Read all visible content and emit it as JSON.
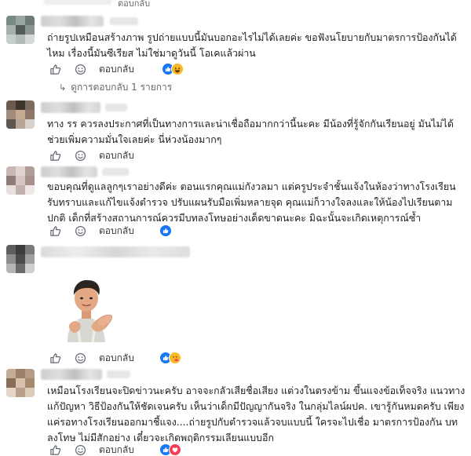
{
  "top": {
    "reply_label": "ตอบกลับ"
  },
  "comments": [
    {
      "text": "ถ่ายรูปเหมือนสร้างภาพ รูปถ่ายแบบนี้มันบอกอะไรไม่ได้เลยค่ะ ขอฟังนโยบายกับมาตรการป้องกันได้ไหม เรื่องนี้มันซีเรียส ไม่ใช่มาดูวันนี้ โอเคแล้วผ่าน",
      "reply_label": "ตอบกลับ",
      "reactions": [
        "like",
        "haha"
      ]
    },
    {
      "text": "ทาง รร ควรลงประกาศที่เป็นทางการและน่าเชื่อถือมากกว่านี้นะคะ มีน้องที่รู้จักกันเรียนอยู่ มันไม่ได้ช่วยเพิ่มความมั่นใจเลยค่ะ นี่ห่วงน้องมากๆ",
      "reply_label": "ตอบกลับ",
      "reactions": []
    },
    {
      "text": "ขอบคุณที่ดูแลลูกๆเราอย่างดีค่ะ ตอนแรกคุณแม่กังวลมา แต่ครูประจำชั้นแจ้งในห้องว่าทางโรงเรียนรับทราบและแก้ไขแจ้งตำรวจ ปรับแผนรับมือเพิ่มหลายจุด คุณแม่ก็วางใจลงและให้น้องไปเรียนตามปกติ เด็กที่สร้างสถานการณ์ควรมีบทลงโทษอย่างเด็ดขาดนะคะ มิฉะนั้นจะเกิดเหตุการณ์ซ้ำ",
      "reply_label": "ตอบกลับ",
      "reactions": [
        "like"
      ]
    },
    {
      "text": "",
      "reply_label": "ตอบกลับ",
      "reactions": [
        "like",
        "care"
      ]
    },
    {
      "text": "เหมือนโรงเรียนจะปิดข่าวนะครับ อาจจะกลัวเสียชื่อเสียง แต่วงในตรงข้าม ขึ้นแจงข้อเท็จจริง แนวทางแก้ปัญหา วิธีป้องกันให้ชัดเจนครับ เห็นว่าเด็กมีปัญญากันจริง ในกลุ่มไลน์ผปค. เขารู้กันหมดครับ เพียงแค่รอทางโรงเรียนออกมาชี้แจง....ถ่ายรูปกับตำรวจแล้วจบแบบนี้ ใครจะไปเชื่อ มาตรการป้องกัน บทลงโทษ ไม่มีสักอย่าง เดี๋ยวจะเกิดพฤติกรรมเลียนแบบอีก",
      "reply_label": "ตอบกลับ",
      "reactions": [
        "like",
        "love"
      ]
    }
  ],
  "view_replies": "ดูการตอบกลับ 1 รายการ",
  "icons": {
    "like_outline": "thumbs-up-icon",
    "emoji_outline": "smiley-icon",
    "sticker_outline": "sticker-icon"
  },
  "colors": {
    "like": "#1877f2",
    "haha": "#f7b928",
    "love": "#f33e58",
    "secondary_text": "#65676b"
  }
}
